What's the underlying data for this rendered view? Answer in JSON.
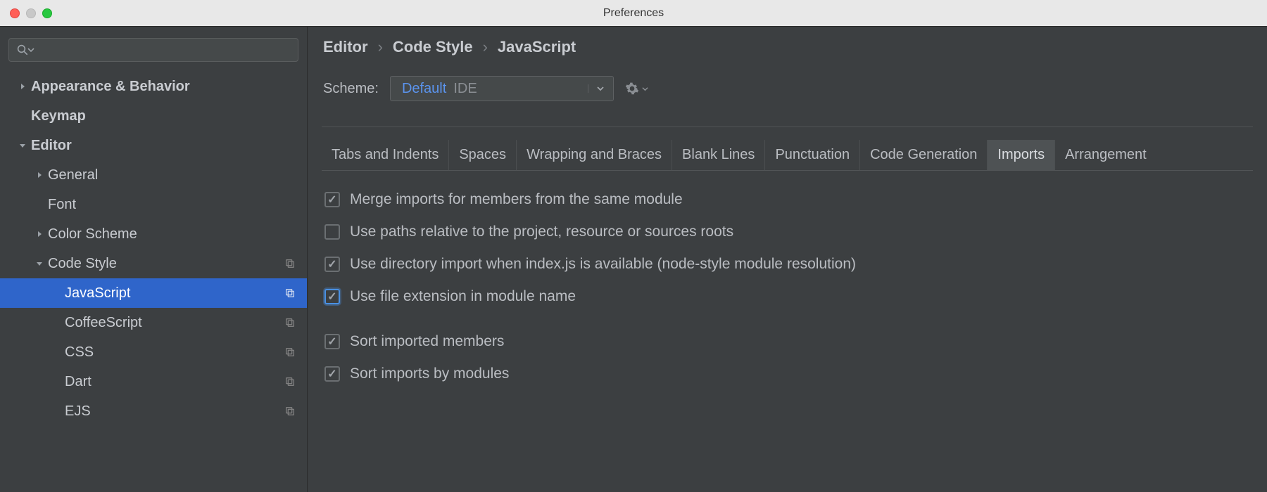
{
  "window": {
    "title": "Preferences"
  },
  "sidebar": {
    "search_placeholder": "",
    "items": [
      {
        "label": "Appearance & Behavior",
        "bold": true,
        "arrow": "right",
        "indent": 0
      },
      {
        "label": "Keymap",
        "bold": true,
        "arrow": "none",
        "indent": 0
      },
      {
        "label": "Editor",
        "bold": true,
        "arrow": "down",
        "indent": 0
      },
      {
        "label": "General",
        "bold": false,
        "arrow": "right",
        "indent": 1
      },
      {
        "label": "Font",
        "bold": false,
        "arrow": "none",
        "indent": 1
      },
      {
        "label": "Color Scheme",
        "bold": false,
        "arrow": "right",
        "indent": 1
      },
      {
        "label": "Code Style",
        "bold": false,
        "arrow": "down",
        "indent": 1,
        "copy": true
      },
      {
        "label": "JavaScript",
        "bold": false,
        "arrow": "none",
        "indent": 2,
        "selected": true,
        "copy": true
      },
      {
        "label": "CoffeeScript",
        "bold": false,
        "arrow": "none",
        "indent": 2,
        "copy": true
      },
      {
        "label": "CSS",
        "bold": false,
        "arrow": "none",
        "indent": 2,
        "copy": true
      },
      {
        "label": "Dart",
        "bold": false,
        "arrow": "none",
        "indent": 2,
        "copy": true
      },
      {
        "label": "EJS",
        "bold": false,
        "arrow": "none",
        "indent": 2,
        "copy": true
      }
    ]
  },
  "breadcrumb": [
    "Editor",
    "Code Style",
    "JavaScript"
  ],
  "scheme": {
    "label": "Scheme:",
    "name": "Default",
    "scope": "IDE"
  },
  "tabs": [
    {
      "label": "Tabs and Indents"
    },
    {
      "label": "Spaces"
    },
    {
      "label": "Wrapping and Braces"
    },
    {
      "label": "Blank Lines"
    },
    {
      "label": "Punctuation"
    },
    {
      "label": "Code Generation"
    },
    {
      "label": "Imports",
      "active": true
    },
    {
      "label": "Arrangement"
    }
  ],
  "checks": [
    {
      "label": "Merge imports for members from the same module",
      "checked": true
    },
    {
      "label": "Use paths relative to the project, resource or sources roots",
      "checked": false
    },
    {
      "label": "Use directory import when index.js is available (node-style module resolution)",
      "checked": true
    },
    {
      "label": "Use file extension in module name",
      "checked": true,
      "focus": true
    },
    {
      "label": "Sort imported members",
      "checked": true,
      "gap": true
    },
    {
      "label": "Sort imports by modules",
      "checked": true
    }
  ]
}
